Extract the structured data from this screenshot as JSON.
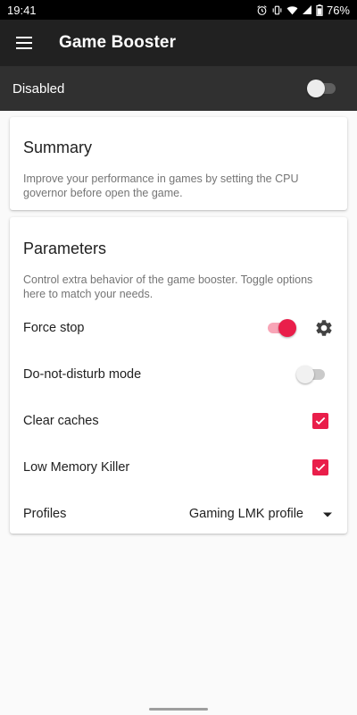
{
  "status_bar": {
    "time": "19:41",
    "battery": "76%"
  },
  "app_bar": {
    "title": "Game Booster"
  },
  "master_switch": {
    "label": "Disabled",
    "on": false
  },
  "summary": {
    "title": "Summary",
    "description": "Improve your performance in games by setting the CPU governor before open the game."
  },
  "parameters": {
    "title": "Parameters",
    "description": "Control extra behavior of the game booster. Toggle options here to match your needs.",
    "force_stop": {
      "label": "Force stop",
      "on": true
    },
    "dnd": {
      "label": "Do-not-disturb mode",
      "on": false
    },
    "clear_caches": {
      "label": "Clear caches",
      "checked": true
    },
    "lmk": {
      "label": "Low Memory Killer",
      "checked": true
    },
    "profiles": {
      "label": "Profiles",
      "value": "Gaming LMK profile"
    }
  },
  "colors": {
    "accent": "#e91e4a",
    "toolbar": "#212121",
    "subbar": "#303030"
  }
}
